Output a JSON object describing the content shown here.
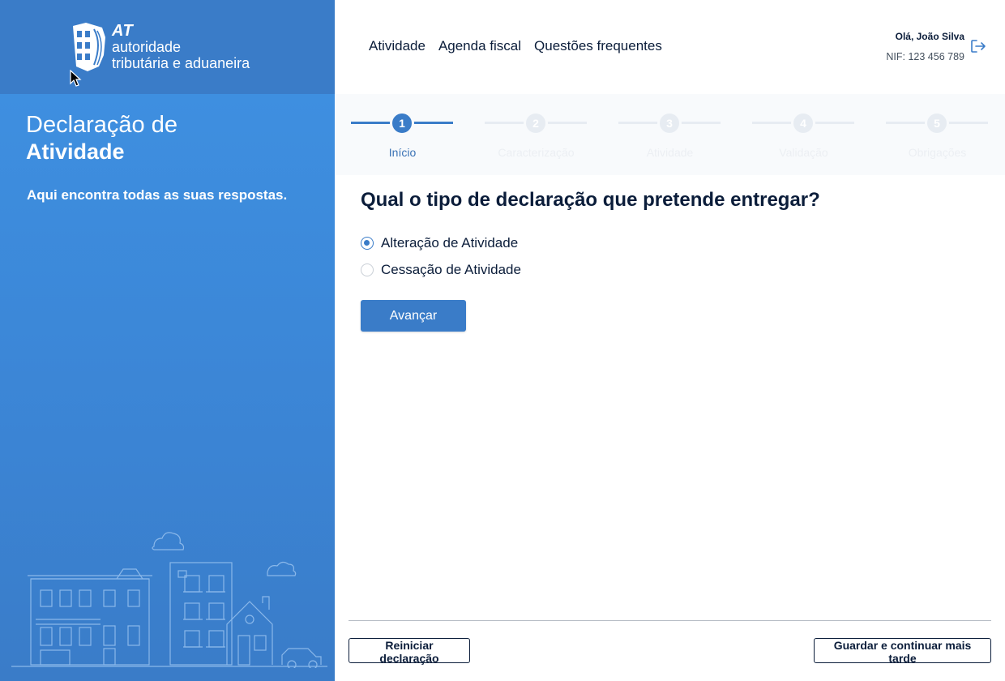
{
  "brand": {
    "at": "AT",
    "line1": "autoridade",
    "line2": "tributária e aduaneira"
  },
  "sidebar": {
    "title_light": "Declaração de",
    "title_bold": "Atividade",
    "subtitle": "Aqui encontra todas as suas respostas."
  },
  "nav": {
    "items": [
      "Atividade",
      "Agenda fiscal",
      "Questões frequentes"
    ]
  },
  "user": {
    "greeting": "Olá, João Silva",
    "nif": "NIF: 123 456 789"
  },
  "stepper": {
    "active_index": 0,
    "steps": [
      {
        "number": "1",
        "label": "Início"
      },
      {
        "number": "2",
        "label": "Caracterização"
      },
      {
        "number": "3",
        "label": "Atividade"
      },
      {
        "number": "4",
        "label": "Validação"
      },
      {
        "number": "5",
        "label": "Obrigações"
      }
    ]
  },
  "form": {
    "question": "Qual o tipo de declaração que pretende entregar?",
    "options": [
      {
        "label": "Alteração de Atividade",
        "selected": true
      },
      {
        "label": "Cessação de Atividade",
        "selected": false
      }
    ],
    "submit_label": "Avançar"
  },
  "footer": {
    "restart_label": "Reiniciar declaração",
    "save_label": "Guardar e continuar mais tarde"
  },
  "colors": {
    "primary": "#3a7cc8",
    "sidebar_top": "#3a7cc8",
    "text_dark": "#0b1d3a"
  },
  "icons": {
    "logout": "logout-icon",
    "emblem": "at-emblem-icon"
  }
}
